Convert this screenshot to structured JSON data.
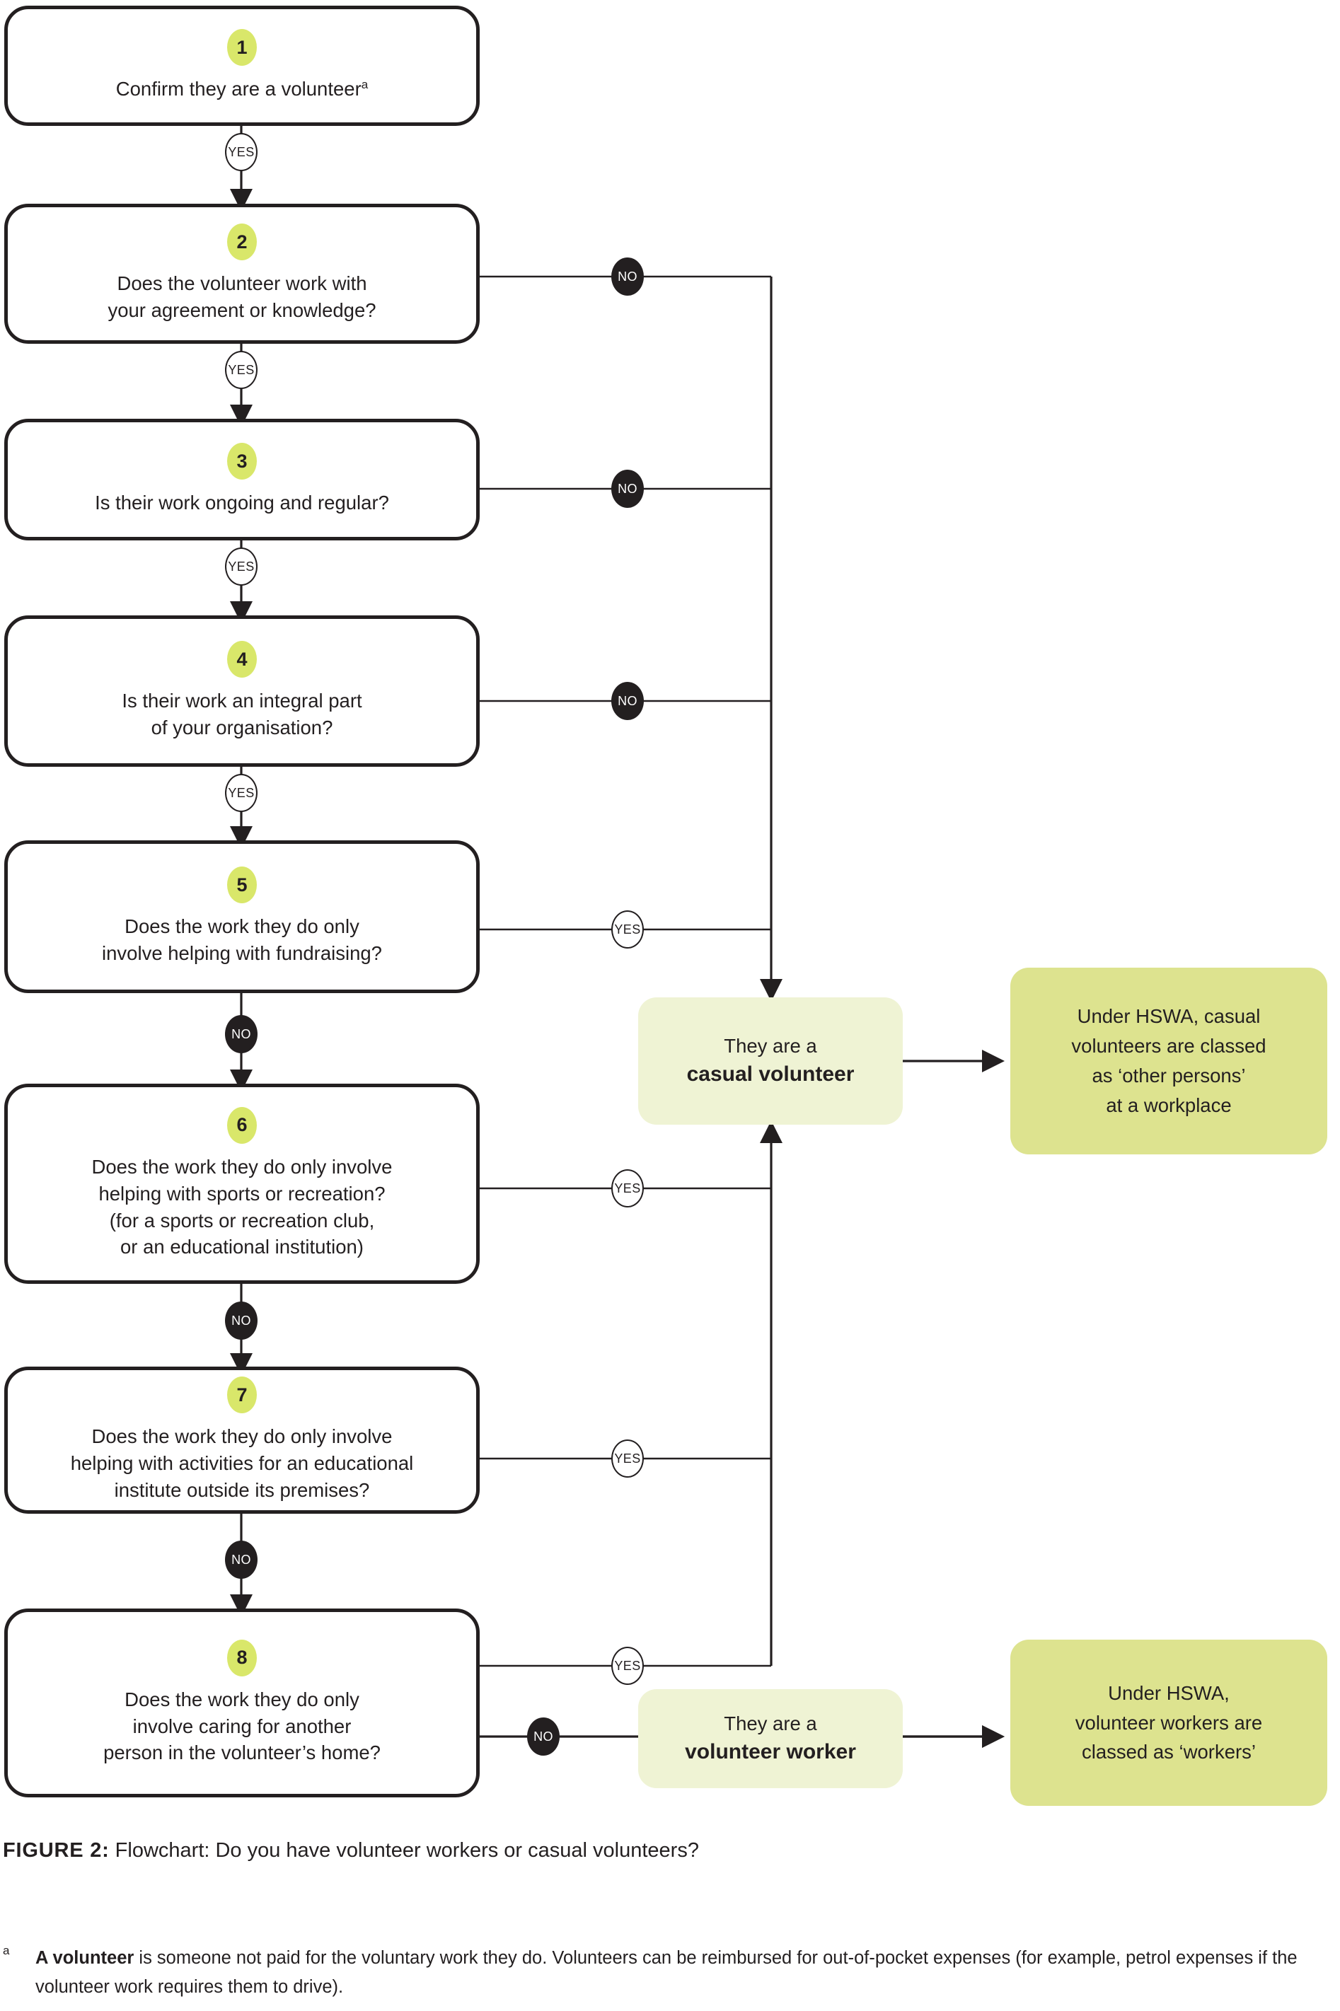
{
  "figure": {
    "label": "FIGURE 2:",
    "caption": "Flowchart: Do you have volunteer workers or casual volunteers?"
  },
  "footnote": {
    "marker": "a",
    "bold_lead": "A volunteer",
    "rest": " is someone not paid for the voluntary work they do. Volunteers can be reimbursed for out-of-pocket expenses (for example, petrol expenses if the volunteer work requires them to drive)."
  },
  "colors": {
    "badge_green": "#d9e76a",
    "outcome_light": "#eff3d4",
    "outcome_dark": "#dde38f",
    "ink": "#231f20",
    "white": "#ffffff"
  },
  "labels": {
    "yes": "YES",
    "no": "NO"
  },
  "chart_data": {
    "type": "diagram",
    "title": "Flowchart: Do you have volunteer workers or casual volunteers?",
    "nodes": [
      {
        "id": 1,
        "number": "1",
        "text": "Confirm they are a volunteer",
        "superscript": "a"
      },
      {
        "id": 2,
        "number": "2",
        "text": "Does the volunteer work with\nyour agreement or knowledge?"
      },
      {
        "id": 3,
        "number": "3",
        "text": "Is their work ongoing and regular?"
      },
      {
        "id": 4,
        "number": "4",
        "text": "Is their work an integral part\nof your organisation?"
      },
      {
        "id": 5,
        "number": "5",
        "text": "Does the work they do only\ninvolve helping with fundraising?"
      },
      {
        "id": 6,
        "number": "6",
        "text": "Does the work they do only involve\nhelping with sports or recreation?\n(for a sports or recreation club,\nor an educational institution)"
      },
      {
        "id": 7,
        "number": "7",
        "text": "Does the work they do only involve\nhelping with activities for an educational\ninstitute outside its premises?"
      },
      {
        "id": 8,
        "number": "8",
        "text": "Does the work they do only\ninvolve caring for another\nperson in the volunteer's home?"
      }
    ],
    "outcomes": [
      {
        "id": "casual",
        "lead": "They are a",
        "strong": "casual volunteer"
      },
      {
        "id": "casual_result",
        "body": "Under HSWA, casual\nvolunteers are classed\nas ‘other persons’\nat a workplace"
      },
      {
        "id": "worker",
        "lead": "They are a",
        "strong": "volunteer worker"
      },
      {
        "id": "worker_result",
        "body": "Under HSWA,\nvolunteer workers are\nclassed as ‘workers’"
      }
    ],
    "edges": [
      {
        "from": 1,
        "to": 2,
        "label": "YES"
      },
      {
        "from": 2,
        "to": 3,
        "label": "YES"
      },
      {
        "from": 2,
        "to": "casual",
        "label": "NO"
      },
      {
        "from": 3,
        "to": 4,
        "label": "YES"
      },
      {
        "from": 3,
        "to": "casual",
        "label": "NO"
      },
      {
        "from": 4,
        "to": 5,
        "label": "YES"
      },
      {
        "from": 4,
        "to": "casual",
        "label": "NO"
      },
      {
        "from": 5,
        "to": 6,
        "label": "NO"
      },
      {
        "from": 5,
        "to": "casual",
        "label": "YES"
      },
      {
        "from": 6,
        "to": 7,
        "label": "NO"
      },
      {
        "from": 6,
        "to": "casual",
        "label": "YES"
      },
      {
        "from": 7,
        "to": 8,
        "label": "NO"
      },
      {
        "from": 7,
        "to": "casual",
        "label": "YES"
      },
      {
        "from": 8,
        "to": "casual",
        "label": "YES"
      },
      {
        "from": 8,
        "to": "worker",
        "label": "NO"
      },
      {
        "from": "casual",
        "to": "casual_result",
        "label": ""
      },
      {
        "from": "worker",
        "to": "worker_result",
        "label": ""
      }
    ]
  },
  "nodes": {
    "n1": {
      "number": "1",
      "text": "Confirm they are a volunteer",
      "sup": "a"
    },
    "n2": {
      "number": "2",
      "text": "Does the volunteer work with\nyour agreement or knowledge?"
    },
    "n3": {
      "number": "3",
      "text": "Is their work ongoing and regular?"
    },
    "n4": {
      "number": "4",
      "text": "Is their work an integral part\nof your organisation?"
    },
    "n5": {
      "number": "5",
      "text": "Does the work they do only\ninvolve helping with fundraising?"
    },
    "n6": {
      "number": "6",
      "text": "Does the work they do only involve\nhelping with sports or recreation?\n(for a sports or recreation club,\nor an educational institution)"
    },
    "n7": {
      "number": "7",
      "text": "Does the work they do only involve\nhelping with activities for an educational\ninstitute outside its premises?"
    },
    "n8": {
      "number": "8",
      "text": "Does the work they do only\ninvolve caring for another\nperson in the volunteer’s home?"
    }
  },
  "outcomes": {
    "casual": {
      "lead": "They are a",
      "strong": "casual volunteer"
    },
    "casual_result": {
      "body": "Under HSWA, casual\nvolunteers are classed\nas ‘other persons’\nat a workplace"
    },
    "worker": {
      "lead": "They are a",
      "strong": "volunteer worker"
    },
    "worker_result": {
      "body": "Under HSWA,\nvolunteer workers are\nclassed as ‘workers’"
    }
  }
}
